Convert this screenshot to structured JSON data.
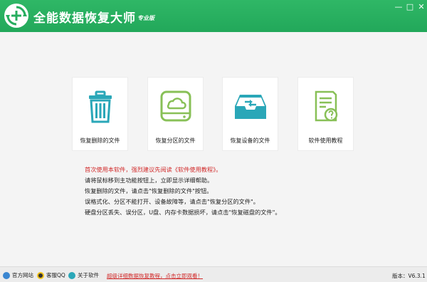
{
  "app": {
    "title": "全能数据恢复大师",
    "edition": "专业版"
  },
  "window": {
    "minimize": "—",
    "maximize": "□",
    "close": "✕"
  },
  "cards": [
    {
      "label": "恢复删除的文件",
      "icon": "trash-bin-icon"
    },
    {
      "label": "恢复分区的文件",
      "icon": "hard-drive-icon"
    },
    {
      "label": "恢复设备的文件",
      "icon": "device-tray-icon"
    },
    {
      "label": "软件使用教程",
      "icon": "help-document-icon"
    }
  ],
  "notes": {
    "warning": "首次使用本软件，强烈建议先阅读《软件使用教程》。",
    "lines": [
      "请将鼠标移到主功能按钮上，立即显示详细帮助。",
      "恢复删除的文件，请点击\"恢复删除的文件\"按钮。",
      "误格式化、分区不能打开、设备故障等，请点击\"恢复分区的文件\"。",
      "硬盘分区丢失、误分区，U盘、内存卡数据损坏，请点击\"恢复磁盘的文件\"。"
    ]
  },
  "statusbar": {
    "site": "官方网站",
    "qq": "客服QQ",
    "about": "关于软件",
    "link": "超级详细数据恢复教程，点击立即观看！",
    "version_label": "版本：",
    "version": "V6.3.1"
  },
  "colors": {
    "brand": "#26ad5e",
    "icon_teal": "#2aa7b8",
    "icon_green": "#88c057",
    "warning": "#d12a2a"
  }
}
